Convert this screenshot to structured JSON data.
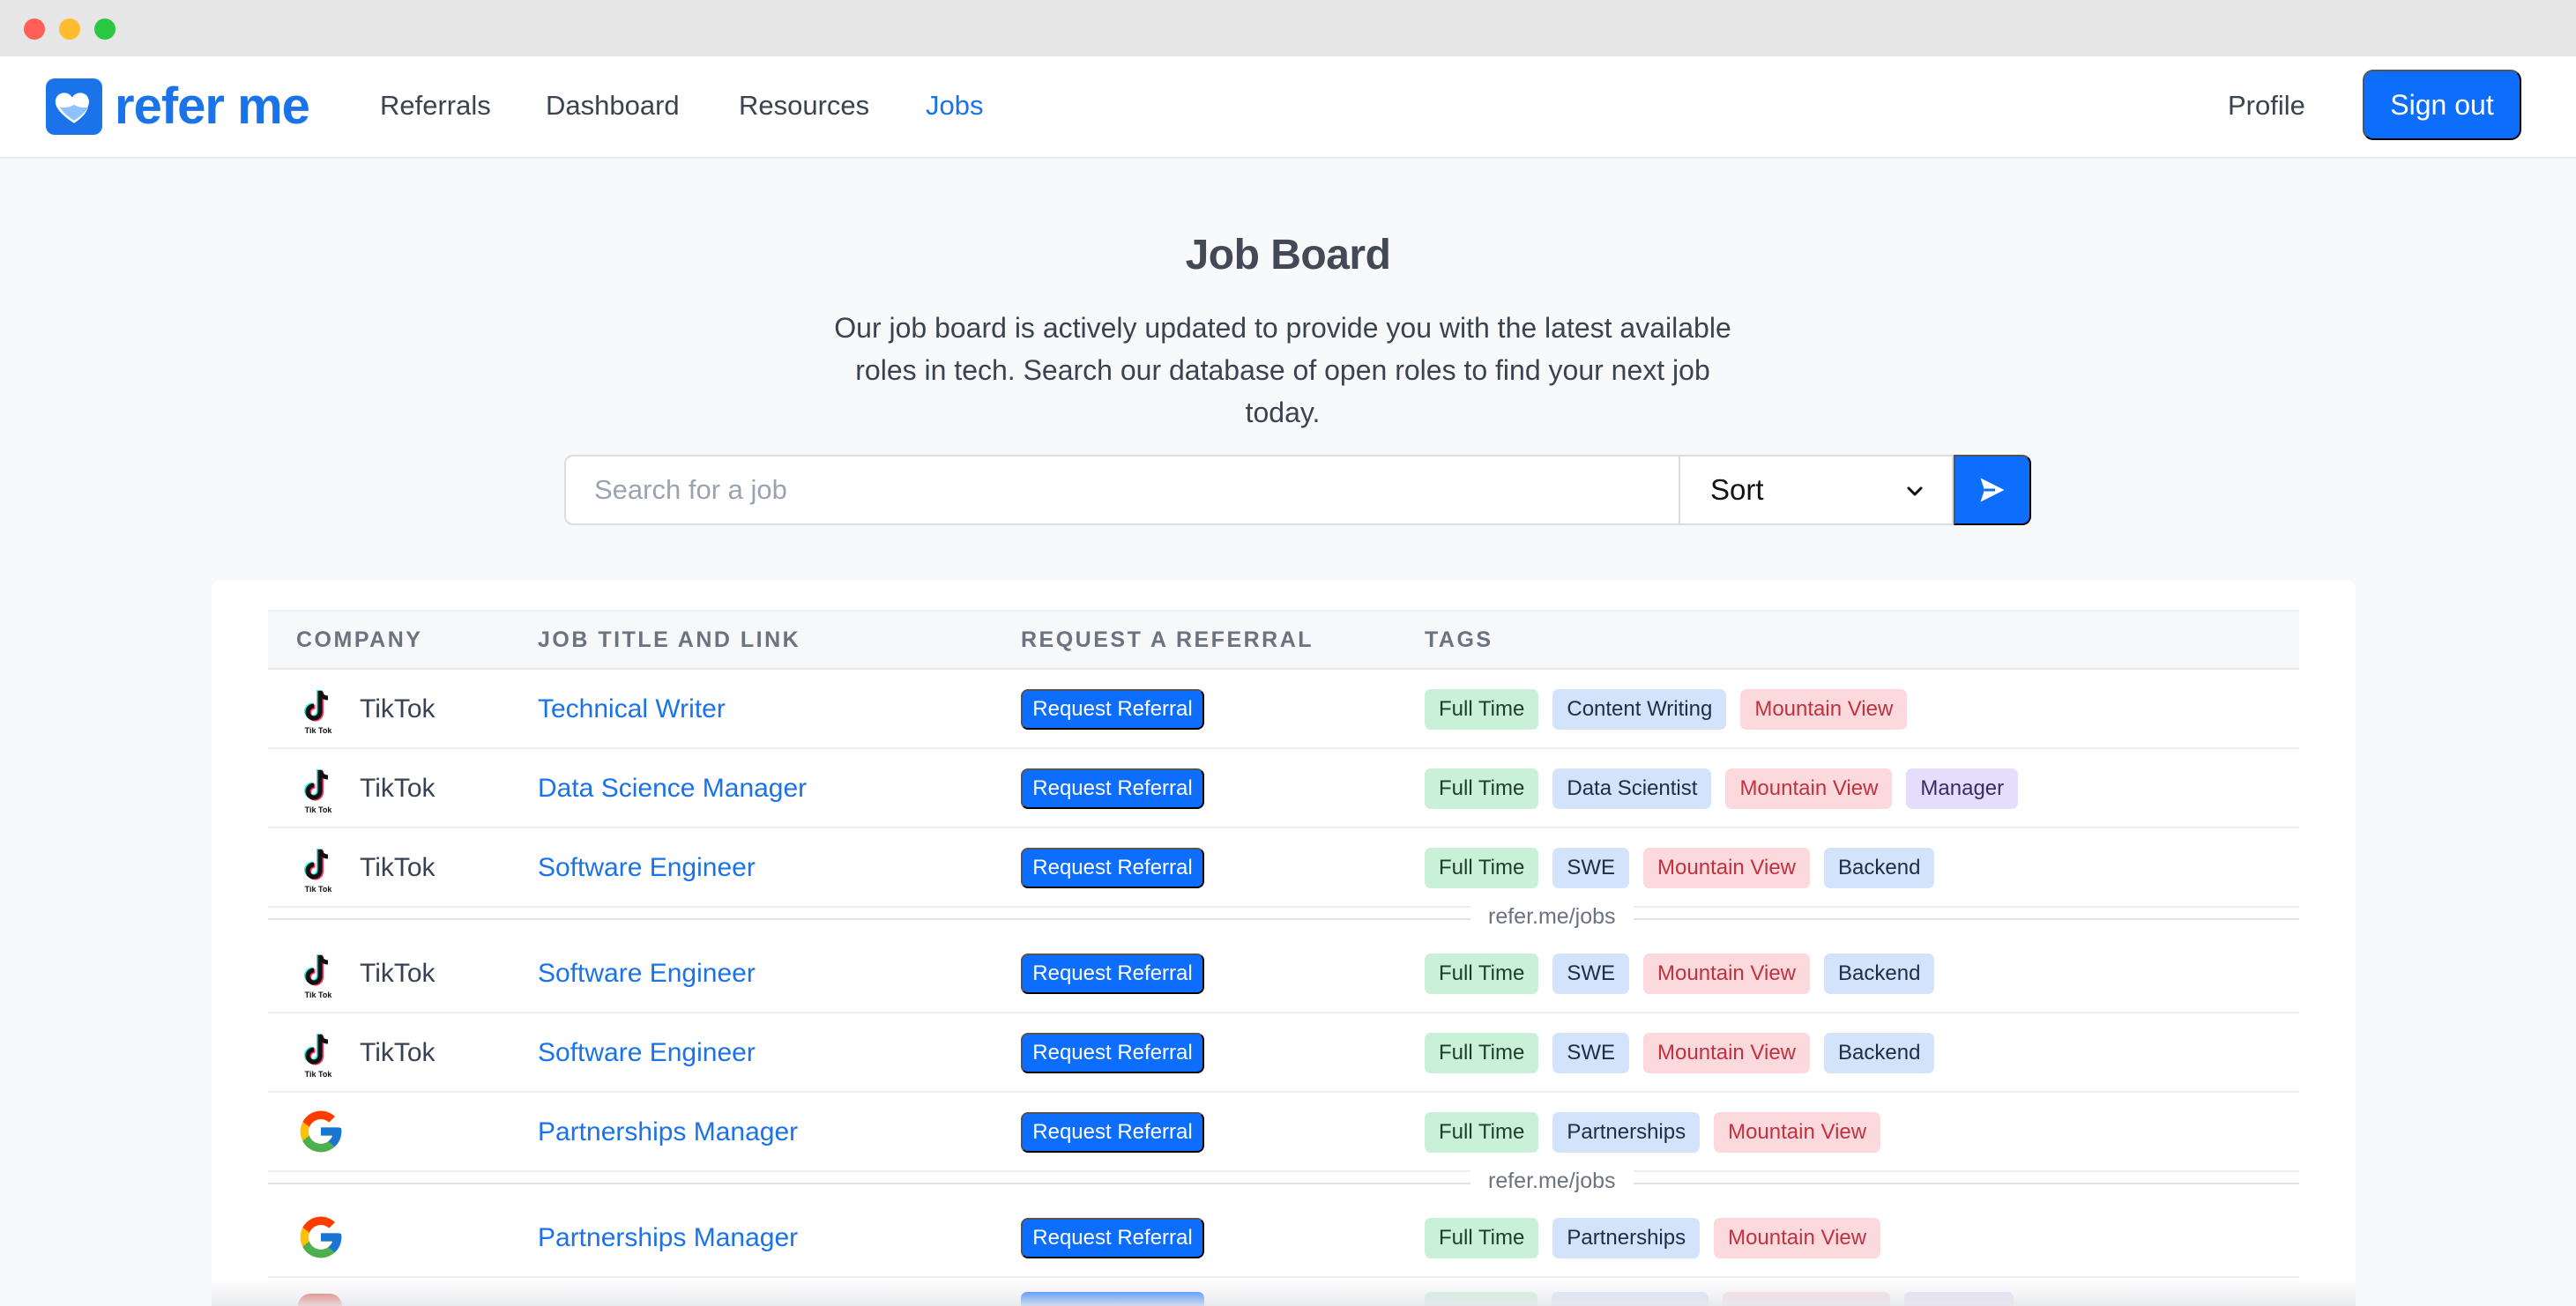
{
  "nav": {
    "brand": "refer me",
    "links": [
      "Referrals",
      "Dashboard",
      "Resources",
      "Jobs"
    ],
    "active": "Jobs",
    "profile": "Profile",
    "signout": "Sign out"
  },
  "hero": {
    "title": "Job Board",
    "subtitle": "Our job board is actively updated to provide you with the latest available roles in tech. Search our database of open roles to find your next job today."
  },
  "search": {
    "placeholder": "Search for a job",
    "sort_label": "Sort"
  },
  "table": {
    "headers": [
      "Company",
      "Job Title and Link",
      "Request a Referral",
      "Tags"
    ],
    "referral_label": "Request Referral",
    "divider_label": "refer.me/jobs",
    "rows": [
      {
        "company": "TikTok",
        "logo": "tiktok-logo",
        "title": "Technical Writer",
        "tags": [
          [
            "Full Time",
            "green"
          ],
          [
            "Content Writing",
            "blue"
          ],
          [
            "Mountain View",
            "red"
          ]
        ]
      },
      {
        "company": "TikTok",
        "logo": "tiktok-logo",
        "title": "Data Science Manager",
        "tags": [
          [
            "Full Time",
            "green"
          ],
          [
            "Data Scientist",
            "blue"
          ],
          [
            "Mountain View",
            "red"
          ],
          [
            "Manager",
            "purple"
          ]
        ]
      },
      {
        "company": "TikTok",
        "logo": "tiktok-logo",
        "title": "Software Engineer",
        "tags": [
          [
            "Full Time",
            "green"
          ],
          [
            "SWE",
            "blue"
          ],
          [
            "Mountain View",
            "red"
          ],
          [
            "Backend",
            "blue"
          ]
        ]
      },
      {
        "company": "TikTok",
        "logo": "tiktok-logo",
        "title": "Software Engineer",
        "tags": [
          [
            "Full Time",
            "green"
          ],
          [
            "SWE",
            "blue"
          ],
          [
            "Mountain View",
            "red"
          ],
          [
            "Backend",
            "blue"
          ]
        ]
      },
      {
        "company": "TikTok",
        "logo": "tiktok-logo",
        "title": "Software Engineer",
        "tags": [
          [
            "Full Time",
            "green"
          ],
          [
            "SWE",
            "blue"
          ],
          [
            "Mountain View",
            "red"
          ],
          [
            "Backend",
            "blue"
          ]
        ]
      },
      {
        "company": "",
        "logo": "google-logo",
        "title": "Partnerships Manager",
        "tags": [
          [
            "Full Time",
            "green"
          ],
          [
            "Partnerships",
            "blue"
          ],
          [
            "Mountain View",
            "red"
          ]
        ]
      },
      {
        "company": "",
        "logo": "google-logo",
        "title": "Partnerships Manager",
        "tags": [
          [
            "Full Time",
            "green"
          ],
          [
            "Partnerships",
            "blue"
          ],
          [
            "Mountain View",
            "red"
          ]
        ]
      }
    ]
  },
  "colors": {
    "primary": "#0d6efd",
    "brand": "#1a73e8"
  }
}
